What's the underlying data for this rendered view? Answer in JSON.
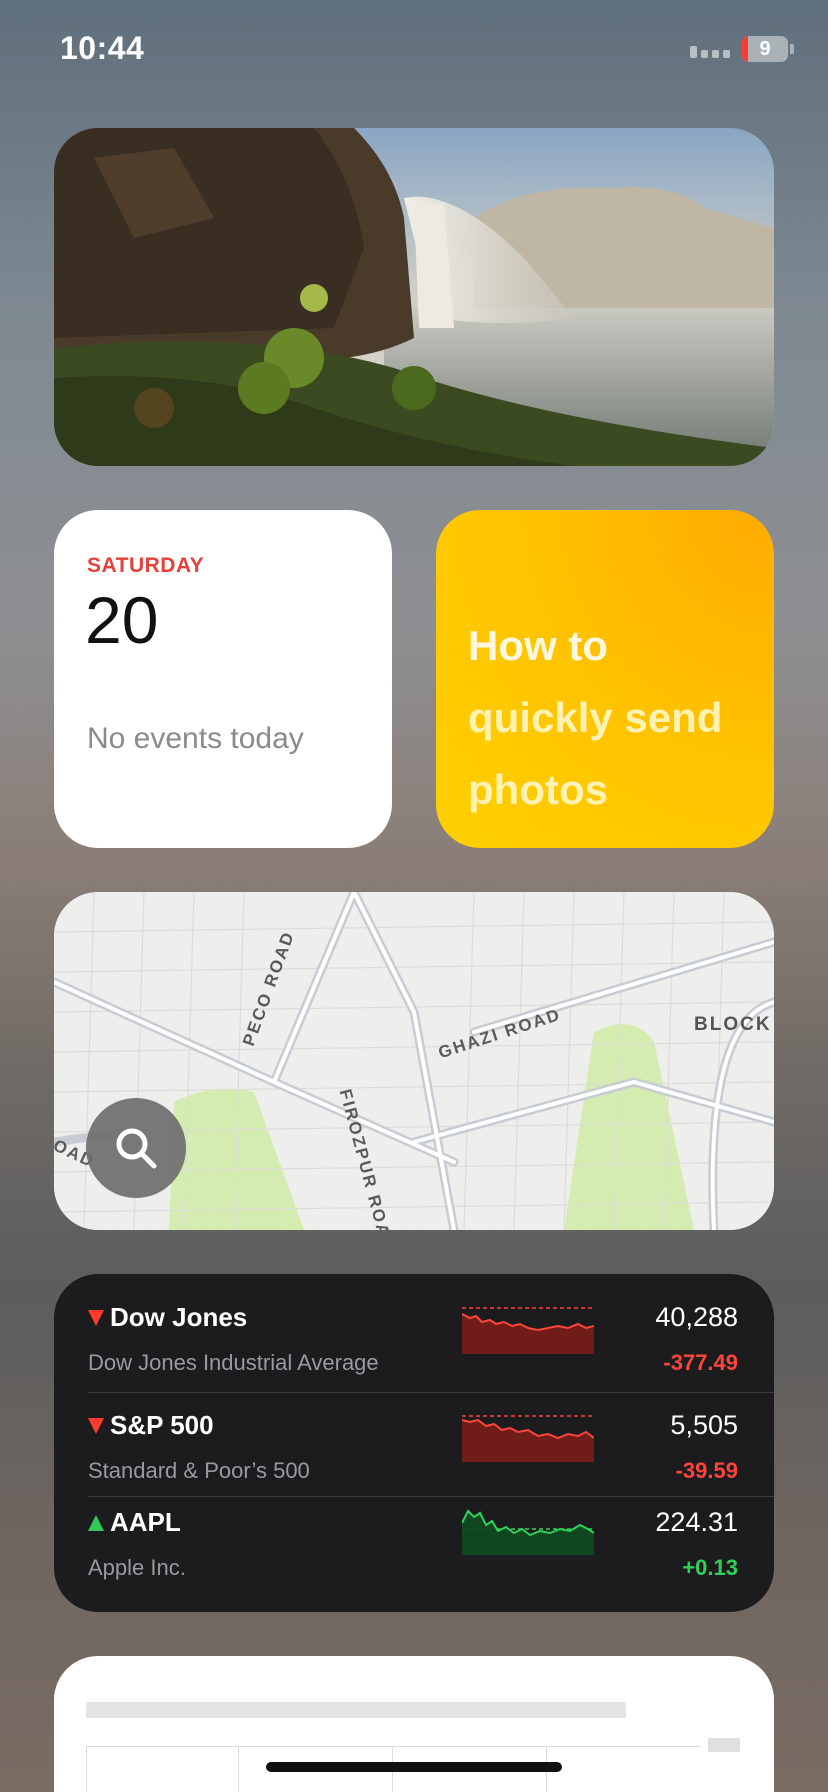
{
  "status_bar": {
    "time": "10:44",
    "battery_level": "9",
    "battery_color": "#ff3b30"
  },
  "photo_widget": {
    "icon": "photo-waterfall"
  },
  "calendar": {
    "day": "SATURDAY",
    "date": "20",
    "events": "No events today",
    "accent": "#e5423a"
  },
  "tips": {
    "line1": "How to",
    "line2": "quickly send",
    "line3": "photos",
    "color": "#ffc400"
  },
  "map": {
    "labels": {
      "peco": "PECO ROAD",
      "ghazi": "GHAZI ROAD",
      "firozpur": "FIROZPUR ROAD",
      "block": "BLOCK G",
      "oad": "OAD"
    },
    "search_icon": "magnifying-glass-icon"
  },
  "stocks": {
    "rows": [
      {
        "symbol": "Dow Jones",
        "name": "Dow Jones Industrial Average",
        "price": "40,288",
        "change": "-377.49",
        "direction": "down"
      },
      {
        "symbol": "S&P 500",
        "name": "Standard & Poor’s 500",
        "price": "5,505",
        "change": "-39.59",
        "direction": "down"
      },
      {
        "symbol": "AAPL",
        "name": "Apple Inc.",
        "price": "224.31",
        "change": "+0.13",
        "direction": "up"
      }
    ],
    "down_color": "#ff453a",
    "up_color": "#30d158"
  }
}
